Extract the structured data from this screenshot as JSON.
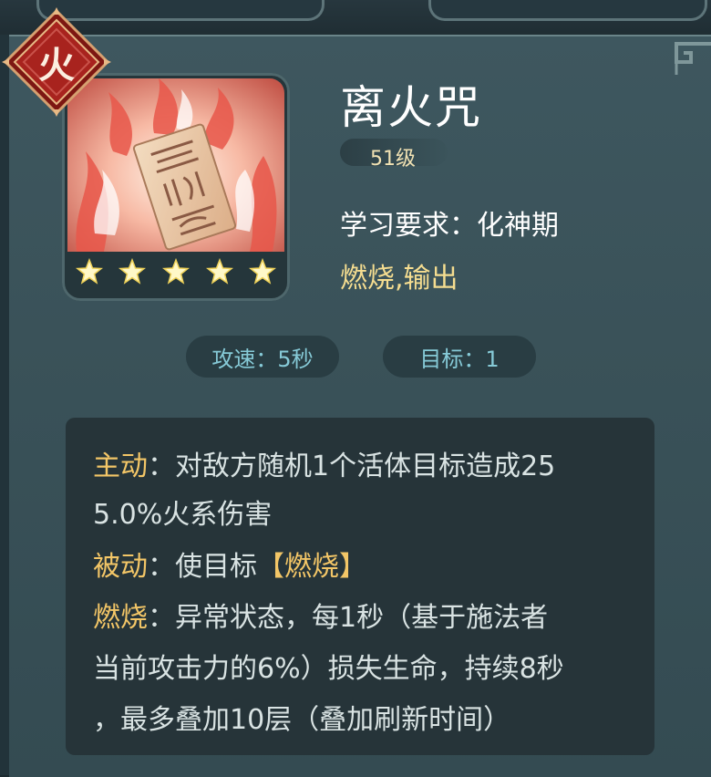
{
  "element_badge": {
    "glyph": "火",
    "icon": "fire-element-badge"
  },
  "skill": {
    "name": "离火咒",
    "level": "51级",
    "requirement": "学习要求：化神期",
    "tags": "燃烧,输出",
    "stars": 5,
    "art_icon": "fire-talisman-art",
    "star_icon": "star-icon"
  },
  "stats": {
    "attack_speed": "攻速：5秒",
    "targets": "目标：1"
  },
  "description": {
    "active_label": "主动",
    "active_text_1": "：对敌方随机1个活体目标造成25",
    "active_text_2": "5.0%火系伤害",
    "passive_label": "被动",
    "passive_text": "：使目标",
    "passive_status": "【燃烧】",
    "burn_label": "燃烧",
    "burn_text_1": "：异常状态，每1秒（基于施法者",
    "burn_text_2": "当前攻击力的6%）损失生命，持续8秒",
    "burn_text_3": "，最多叠加10层（叠加刷新时间）"
  },
  "colors": {
    "highlight": "#f3c667",
    "tag": "#f5dd90",
    "stat_text": "#86cad7",
    "badge_red": "#a8231e"
  }
}
